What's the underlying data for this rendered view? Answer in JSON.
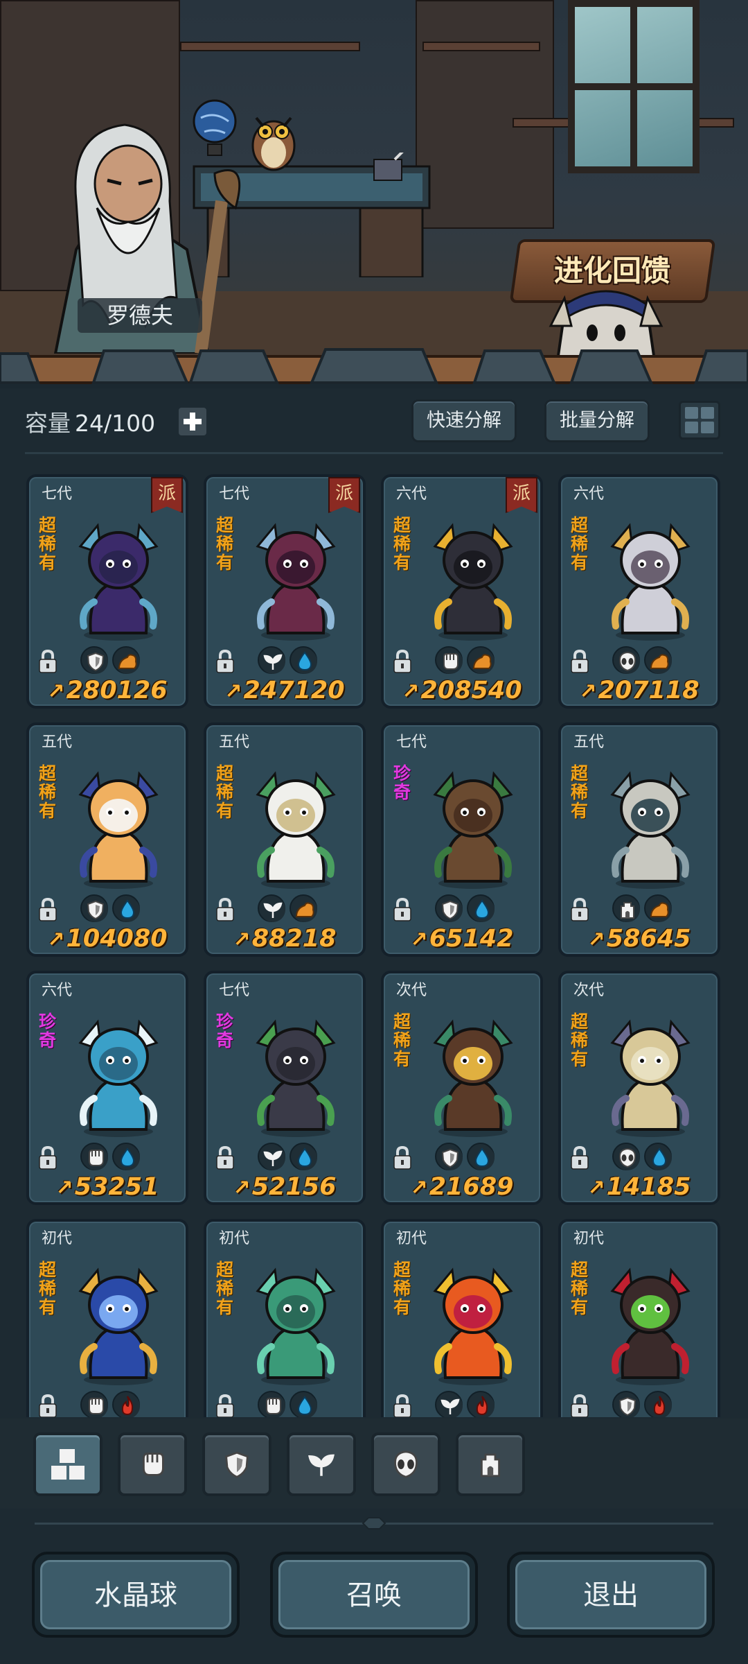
{
  "scene": {
    "npc_name": "罗德夫",
    "evolution_feedback_label": "进化回馈"
  },
  "toolbar": {
    "capacity_label": "容量",
    "capacity_value": "24/100",
    "quick_decompose_label": "快速分解",
    "batch_decompose_label": "批量分解"
  },
  "monsters": [
    {
      "gen": "七代",
      "faction": "派",
      "rarity": "超稀有",
      "power": "280126",
      "elem1": "shield-icon",
      "elem2": "earth-icon"
    },
    {
      "gen": "七代",
      "faction": "派",
      "rarity": "超稀有",
      "power": "247120",
      "elem1": "sprout-icon",
      "elem2": "water-icon"
    },
    {
      "gen": "六代",
      "faction": "派",
      "rarity": "超稀有",
      "power": "208540",
      "elem1": "fist-icon",
      "elem2": "earth-icon"
    },
    {
      "gen": "六代",
      "faction": "",
      "rarity": "超稀有",
      "power": "207118",
      "elem1": "alien-icon",
      "elem2": "earth-icon"
    },
    {
      "gen": "五代",
      "faction": "",
      "rarity": "超稀有",
      "power": "104080",
      "elem1": "shield-icon",
      "elem2": "water-icon"
    },
    {
      "gen": "五代",
      "faction": "",
      "rarity": "超稀有",
      "power": "88218",
      "elem1": "sprout-icon",
      "elem2": "earth-icon"
    },
    {
      "gen": "七代",
      "faction": "",
      "rarity": "珍奇",
      "power": "65142",
      "elem1": "shield-icon",
      "elem2": "water-icon"
    },
    {
      "gen": "五代",
      "faction": "",
      "rarity": "超稀有",
      "power": "58645",
      "elem1": "tower-icon",
      "elem2": "earth-icon"
    },
    {
      "gen": "六代",
      "faction": "",
      "rarity": "珍奇",
      "power": "53251",
      "elem1": "fist-icon",
      "elem2": "water-icon"
    },
    {
      "gen": "七代",
      "faction": "",
      "rarity": "珍奇",
      "power": "52156",
      "elem1": "sprout-icon",
      "elem2": "water-icon"
    },
    {
      "gen": "次代",
      "faction": "",
      "rarity": "超稀有",
      "power": "21689",
      "elem1": "shield-icon",
      "elem2": "water-icon"
    },
    {
      "gen": "次代",
      "faction": "",
      "rarity": "超稀有",
      "power": "14185",
      "elem1": "alien-icon",
      "elem2": "water-icon"
    },
    {
      "gen": "初代",
      "faction": "",
      "rarity": "超稀有",
      "power": "",
      "elem1": "fist-icon",
      "elem2": "fire-icon"
    },
    {
      "gen": "初代",
      "faction": "",
      "rarity": "超稀有",
      "power": "",
      "elem1": "fist-icon",
      "elem2": "water-icon"
    },
    {
      "gen": "初代",
      "faction": "",
      "rarity": "超稀有",
      "power": "",
      "elem1": "sprout-icon",
      "elem2": "fire-icon"
    },
    {
      "gen": "初代",
      "faction": "",
      "rarity": "超稀有",
      "power": "",
      "elem1": "shield-icon",
      "elem2": "fire-icon"
    }
  ],
  "filter_tabs": [
    "all-types-icon",
    "fist-icon",
    "shield-icon",
    "sprout-icon",
    "alien-icon",
    "tower-icon"
  ],
  "bottom": {
    "crystal_ball_label": "水晶球",
    "summon_label": "召唤",
    "exit_label": "退出"
  },
  "colors": {
    "rarity_super_rare": "#f0a21a",
    "rarity_rare": "#e13ae0",
    "power_text": "#ffb43a",
    "card_bg": "#2e4956",
    "water": "#2aa6e0",
    "earth": "#e8902a",
    "fire": "#e03a2a"
  }
}
